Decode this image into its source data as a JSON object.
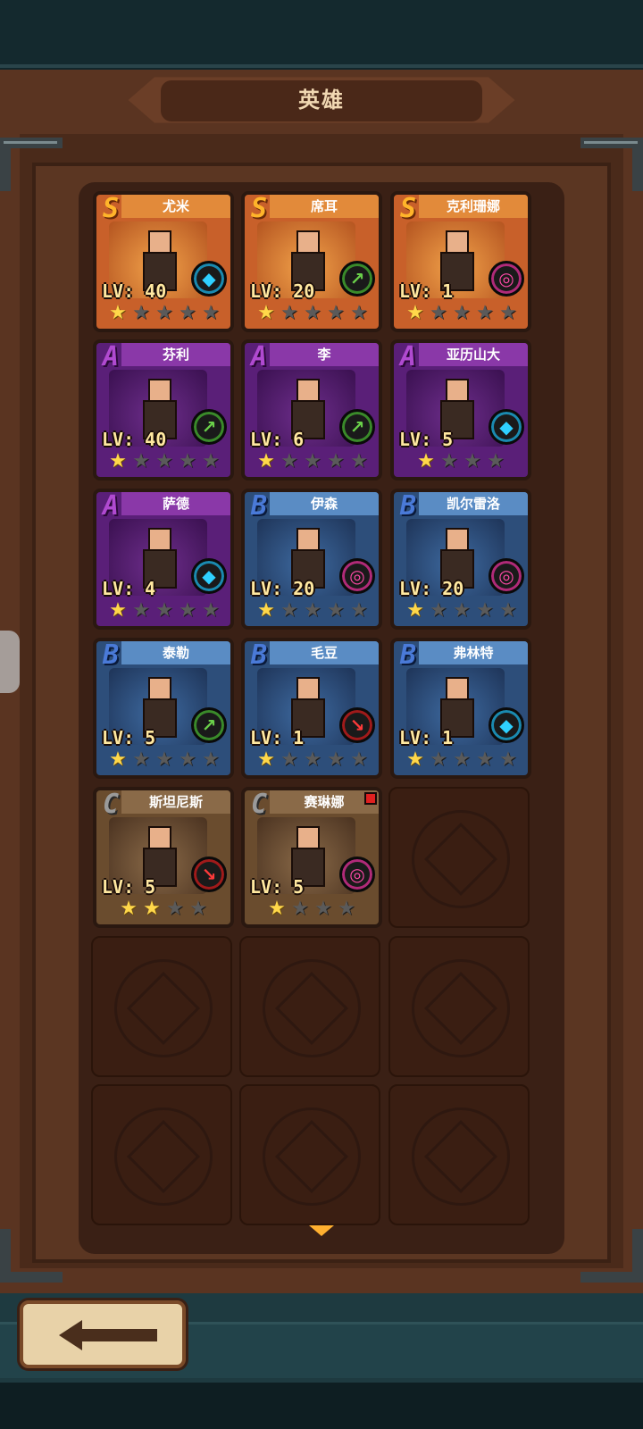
{
  "header": {
    "title": "英雄"
  },
  "heroes": [
    {
      "rank": "S",
      "name": "尤米",
      "level": "LV: 40",
      "role": "mage",
      "role_icon": "◆",
      "stars": 1,
      "star_total": 5
    },
    {
      "rank": "S",
      "name": "席耳",
      "level": "LV: 20",
      "role": "ranger",
      "role_icon": "↗",
      "stars": 1,
      "star_total": 5
    },
    {
      "rank": "S",
      "name": "克利珊娜",
      "level": "LV: 1",
      "role": "support",
      "role_icon": "◎",
      "stars": 1,
      "star_total": 5
    },
    {
      "rank": "A",
      "name": "芬利",
      "level": "LV: 40",
      "role": "ranger",
      "role_icon": "↗",
      "stars": 1,
      "star_total": 5
    },
    {
      "rank": "A",
      "name": "李",
      "level": "LV: 6",
      "role": "ranger",
      "role_icon": "↗",
      "stars": 1,
      "star_total": 5
    },
    {
      "rank": "A",
      "name": "亚历山大",
      "level": "LV: 5",
      "role": "mage",
      "role_icon": "◆",
      "stars": 1,
      "star_total": 4
    },
    {
      "rank": "A",
      "name": "萨德",
      "level": "LV: 4",
      "role": "mage",
      "role_icon": "◆",
      "stars": 1,
      "star_total": 5
    },
    {
      "rank": "B",
      "name": "伊森",
      "level": "LV: 20",
      "role": "support",
      "role_icon": "◎",
      "stars": 1,
      "star_total": 5
    },
    {
      "rank": "B",
      "name": "凯尔雷洛",
      "level": "LV: 20",
      "role": "support",
      "role_icon": "◎",
      "stars": 1,
      "star_total": 5
    },
    {
      "rank": "B",
      "name": "泰勒",
      "level": "LV: 5",
      "role": "ranger",
      "role_icon": "↗",
      "stars": 1,
      "star_total": 5
    },
    {
      "rank": "B",
      "name": "毛豆",
      "level": "LV: 1",
      "role": "warrior",
      "role_icon": "↘",
      "stars": 1,
      "star_total": 5
    },
    {
      "rank": "B",
      "name": "弗林特",
      "level": "LV: 1",
      "role": "mage",
      "role_icon": "◆",
      "stars": 1,
      "star_total": 5
    },
    {
      "rank": "C",
      "name": "斯坦尼斯",
      "level": "LV: 5",
      "role": "warrior",
      "role_icon": "↘",
      "stars": 2,
      "star_total": 4
    },
    {
      "rank": "C",
      "name": "赛琳娜",
      "level": "LV: 5",
      "role": "support",
      "role_icon": "◎",
      "stars": 1,
      "star_total": 4,
      "notify": true
    }
  ],
  "empty_slots": 7,
  "rank_glyphs": {
    "S": "S",
    "A": "A",
    "B": "B",
    "C": "C"
  },
  "star_glyph": "★",
  "footer": {
    "back_icon": "arrow-left-icon"
  }
}
